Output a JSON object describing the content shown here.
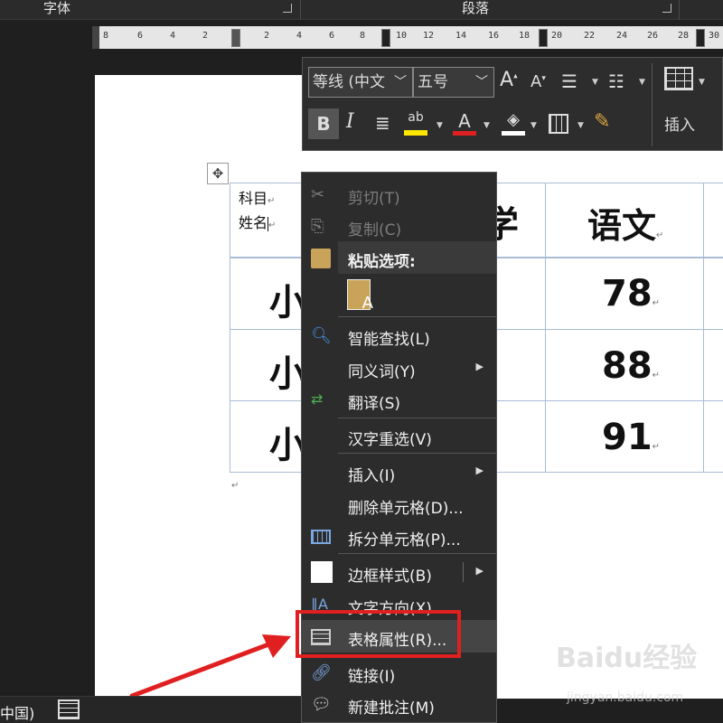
{
  "ribbon": {
    "font_group": "字体",
    "paragraph_group": "段落"
  },
  "ruler": {
    "left_numbers": [
      "8",
      "6",
      "4",
      "2"
    ],
    "right_numbers": [
      "2",
      "4",
      "6",
      "8",
      "10",
      "12",
      "14",
      "16",
      "18",
      "20",
      "22",
      "24",
      "26",
      "28",
      "30"
    ]
  },
  "mini_toolbar": {
    "font_name": "等线 (中文",
    "font_size": "五号",
    "bold": "B",
    "italic": "I",
    "insert_label": "插入"
  },
  "table": {
    "header_diag_top": "科目",
    "header_diag_bottom": "姓名",
    "header_col_partial": "学",
    "header_col3": "语文",
    "rows": [
      {
        "name_partial": "小",
        "score": "78"
      },
      {
        "name_partial": "小",
        "score": "88"
      },
      {
        "name_partial": "小",
        "score": "91"
      }
    ]
  },
  "context_menu": {
    "cut": "剪切(T)",
    "copy": "复制(C)",
    "paste_options": "粘贴选项:",
    "smart_lookup": "智能查找(L)",
    "synonyms": "同义词(Y)",
    "translate": "翻译(S)",
    "reconvert": "汉字重选(V)",
    "insert": "插入(I)",
    "delete_cells": "删除单元格(D)...",
    "split_cells": "拆分单元格(P)...",
    "border_styles": "边框样式(B)",
    "text_direction": "文字方向(X)...",
    "table_properties": "表格属性(R)...",
    "link": "链接(I)",
    "new_comment": "新建批注(M)"
  },
  "status_bar": {
    "language": "中国)"
  },
  "watermark": {
    "logo": "Baidu经验",
    "url": "jingyan.baidu.com"
  },
  "colors": {
    "highlight_marker": "#ffe600",
    "font_color": "#e02020",
    "annotation": "#e02020"
  }
}
